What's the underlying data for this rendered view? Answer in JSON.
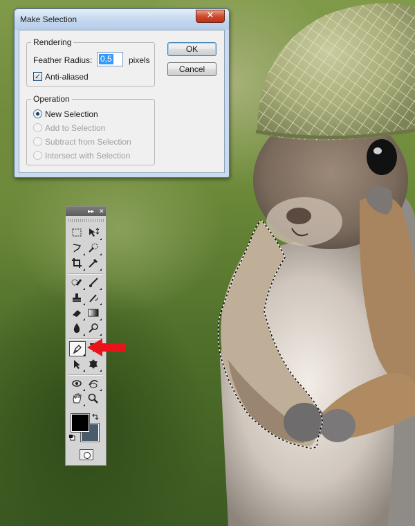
{
  "dialog": {
    "title": "Make Selection",
    "close_symbol": "✕",
    "rendering": {
      "legend": "Rendering",
      "feather_label": "Feather Radius:",
      "feather_value": "0,5",
      "feather_unit": "pixels",
      "anti_aliased_label": "Anti-aliased",
      "anti_aliased_checked": true
    },
    "operation": {
      "legend": "Operation",
      "options": [
        {
          "label": "New Selection",
          "selected": true,
          "enabled": true
        },
        {
          "label": "Add to Selection",
          "selected": false,
          "enabled": false
        },
        {
          "label": "Subtract from Selection",
          "selected": false,
          "enabled": false
        },
        {
          "label": "Intersect with Selection",
          "selected": false,
          "enabled": false
        }
      ]
    },
    "buttons": {
      "ok": "OK",
      "cancel": "Cancel"
    }
  },
  "palette": {
    "header_collapse": "▸▸",
    "header_close": "✕",
    "active_tool": "pen-tool",
    "foreground_color": "#000000",
    "background_color": "#4a5b6a",
    "tools": [
      "rectangular-marquee-tool",
      "move-tool",
      "lasso-tool",
      "quick-selection-tool",
      "crop-tool",
      "eyedropper-tool",
      "spot-healing-brush-tool",
      "brush-tool",
      "clone-stamp-tool",
      "history-brush-tool",
      "eraser-tool",
      "gradient-tool",
      "blur-tool",
      "dodge-tool",
      "pen-tool",
      "type-tool",
      "path-selection-tool",
      "custom-shape-tool",
      "3d-rotate-tool",
      "3d-orbit-tool",
      "hand-tool",
      "zoom-tool"
    ]
  },
  "annotation": {
    "arrow_color": "#e8141a"
  }
}
